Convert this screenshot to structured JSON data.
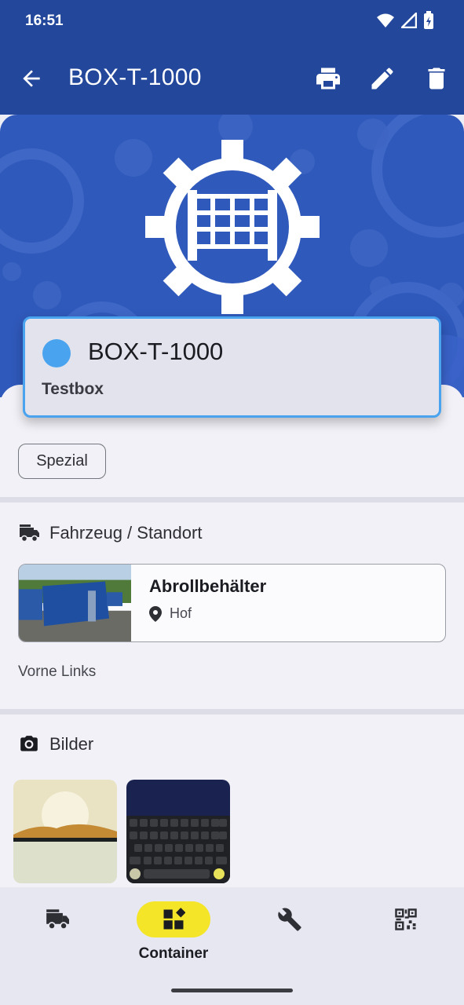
{
  "status_bar": {
    "time": "16:51",
    "icons": [
      "wifi-icon",
      "signal-icon",
      "battery-charging-icon"
    ]
  },
  "app_bar": {
    "title": "BOX-T-1000",
    "actions": [
      "print-icon",
      "edit-icon",
      "delete-icon"
    ]
  },
  "container": {
    "name": "BOX-T-1000",
    "description": "Testbox",
    "status_color": "#4aa3ef",
    "tag": "Spezial"
  },
  "vehicle_section": {
    "heading": "Fahrzeug / Standort",
    "vehicle_name": "Abrollbehälter",
    "location": "Hof",
    "note": "Vorne Links"
  },
  "images_section": {
    "heading": "Bilder"
  },
  "bottom_nav": {
    "items": [
      {
        "icon": "fire-truck-icon",
        "label": ""
      },
      {
        "icon": "container-grid-icon",
        "label": "Container",
        "active": true
      },
      {
        "icon": "wrench-icon",
        "label": ""
      },
      {
        "icon": "qr-code-icon",
        "label": ""
      }
    ]
  },
  "colors": {
    "primary": "#23479a",
    "accent_active": "#f4e528",
    "status_dot": "#4aa3ef"
  }
}
